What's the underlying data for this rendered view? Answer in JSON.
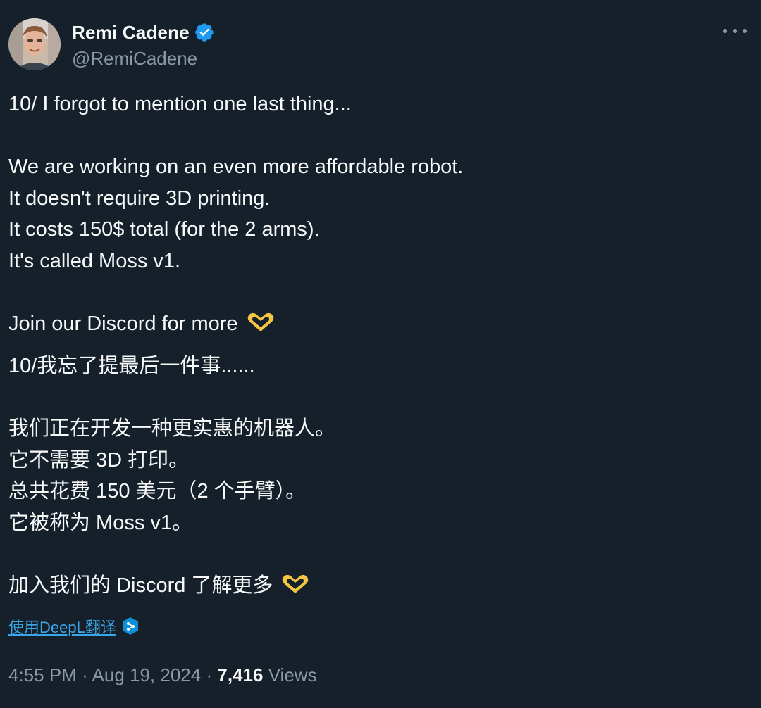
{
  "author": {
    "display_name": "Remi Cadene",
    "handle": "@RemiCadene",
    "verified": true
  },
  "tweet": {
    "en_line1": "10/ I forgot to mention one last thing...",
    "en_line2": "We are working on an even more affordable robot.",
    "en_line3": "It doesn't require 3D printing.",
    "en_line4": "It costs 150$ total (for the 2 arms).",
    "en_line5": "It's called Moss v1.",
    "en_line6": "Join our Discord for more",
    "zh_line1": "10/我忘了提最后一件事......",
    "zh_line2": "我们正在开发一种更实惠的机器人。",
    "zh_line3": "它不需要 3D 打印。",
    "zh_line4": "总共花费 150 美元（2 个手臂）。",
    "zh_line5": "它被称为 Moss v1。",
    "zh_line6": "加入我们的 Discord 了解更多"
  },
  "translate": {
    "label": "使用DeepL翻译"
  },
  "meta": {
    "time": "4:55 PM",
    "sep1": "·",
    "date": "Aug 19, 2024",
    "sep2": "·",
    "views_count": "7,416",
    "views_label": "Views"
  },
  "colors": {
    "background": "#15202b",
    "text": "#f7f9f9",
    "secondary": "#8b98a5",
    "link": "#1d9bf0",
    "verified": "#1d9bf0",
    "heart": "#f4c542"
  },
  "icons": {
    "verified": "verified-badge-icon",
    "more": "more-dots-icon",
    "heart": "heart-hands-emoji-icon",
    "deepl": "deepl-icon"
  }
}
